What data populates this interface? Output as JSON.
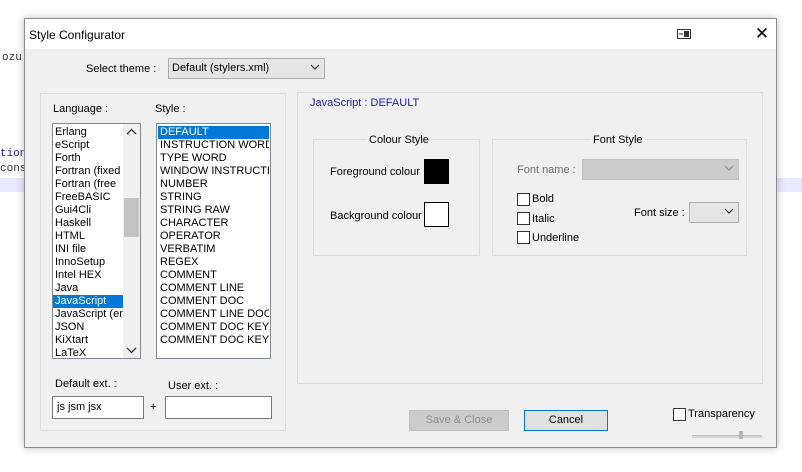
{
  "background_editor": {
    "fragments": [
      "ozu",
      "tion",
      "cons"
    ]
  },
  "dialog": {
    "title": "Style Configurator",
    "select_theme_label": "Select theme :",
    "theme_value": "Default (stylers.xml)",
    "language_label": "Language :",
    "style_label": "Style :",
    "languages": [
      "Erlang",
      "eScript",
      "Forth",
      "Fortran (fixed",
      "Fortran (free",
      "FreeBASIC",
      "Gui4Cli",
      "Haskell",
      "HTML",
      "INI file",
      "InnoSetup",
      "Intel HEX",
      "Java",
      "JavaScript",
      "JavaScript (er",
      "JSON",
      "KiXtart",
      "LaTeX"
    ],
    "selected_language_index": 13,
    "styles": [
      "DEFAULT",
      "INSTRUCTION WORD",
      "TYPE WORD",
      "WINDOW INSTRUCTIO",
      "NUMBER",
      "STRING",
      "STRING RAW",
      "CHARACTER",
      "OPERATOR",
      "VERBATIM",
      "REGEX",
      "COMMENT",
      "COMMENT LINE",
      "COMMENT DOC",
      "COMMENT LINE DOC",
      "COMMENT DOC KEYWO",
      "COMMENT DOC KEYWO"
    ],
    "selected_style_index": 0,
    "default_ext_label": "Default ext. :",
    "default_ext_value": "js jsm jsx",
    "plus_sign": "+",
    "user_ext_label": "User ext. :",
    "user_ext_value": "",
    "style_header": "JavaScript : DEFAULT",
    "colour_style_title": "Colour Style",
    "foreground_label": "Foreground colour",
    "foreground_color": "#000000",
    "background_label": "Background colour",
    "background_color": "#ffffff",
    "font_style_title": "Font Style",
    "font_name_label": "Font name :",
    "font_name_value": "",
    "bold_label": "Bold",
    "italic_label": "Italic",
    "underline_label": "Underline",
    "font_size_label": "Font size :",
    "font_size_value": "",
    "save_close_label": "Save & Close",
    "cancel_label": "Cancel",
    "transparency_label": "Transparency",
    "accent_color": "#0078d7",
    "header_text_color": "#1a1ab4"
  }
}
